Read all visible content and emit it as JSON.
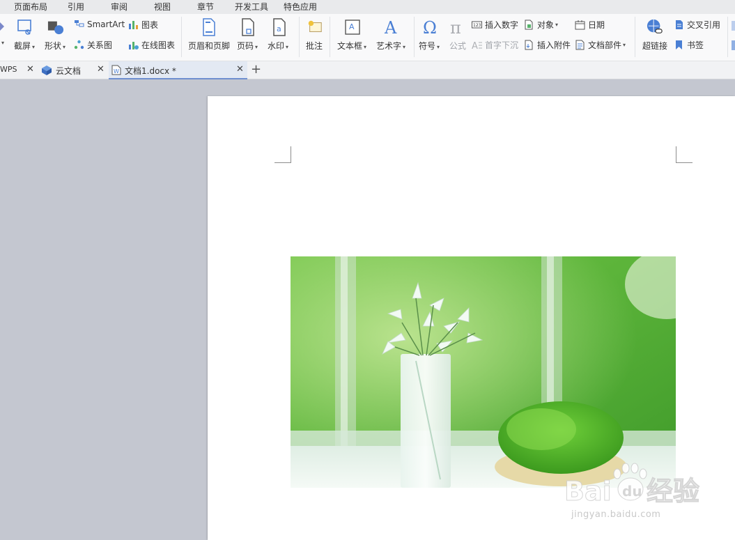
{
  "menu_tabs": [
    "页面布局",
    "引用",
    "审阅",
    "视图",
    "章节",
    "开发工具",
    "特色应用"
  ],
  "ribbon": {
    "screenshot": "截屏",
    "shape": "形状",
    "smartart": "SmartArt",
    "relation_chart": "关系图",
    "chart": "图表",
    "online_chart": "在线图表",
    "header_footer": "页眉和页脚",
    "page_number": "页码",
    "watermark": "水印",
    "comment": "批注",
    "textbox": "文本框",
    "wordart": "艺术字",
    "symbol": "符号",
    "formula": "公式",
    "insert_number": "插入数字",
    "drop_cap": "首字下沉",
    "object": "对象",
    "insert_attachment": "插入附件",
    "date": "日期",
    "doc_parts": "文档部件",
    "hyperlink": "超链接",
    "cross_reference": "交叉引用",
    "bookmark": "书签"
  },
  "doc_tabs": {
    "wps": "WPS",
    "cloud": "云文档",
    "document": "文档1.docx *"
  },
  "watermark": {
    "brand": "Bai du 经验",
    "url": "jingyan.baidu.com"
  },
  "colors": {
    "ribbon_bg": "#f9f9fa",
    "workspace_bg": "#c4c7d0",
    "active_tab": "#e3e9f3",
    "accent_blue": "#4a7fd4"
  }
}
